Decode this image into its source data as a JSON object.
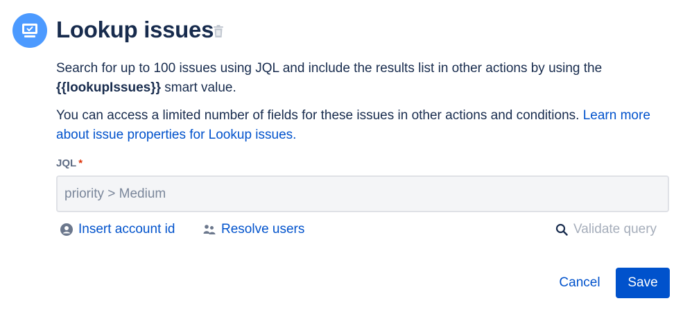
{
  "header": {
    "icon": "monitor-check-icon",
    "title": "Lookup issues",
    "delete_icon": "trash-icon"
  },
  "description": {
    "p1_text": "Search for up to 100 issues using JQL and include the results list in other actions by using the ",
    "p1_smart_value": "{{lookupIssues}}",
    "p1_suffix": " smart value.",
    "p2_text": "You can access a limited number of fields for these issues in other actions and conditions. ",
    "p2_link": "Learn more about issue properties for Lookup issues."
  },
  "form": {
    "jql_label": "JQL",
    "required_marker": "*",
    "jql_value": "",
    "jql_placeholder": "priority > Medium"
  },
  "actions": {
    "insert_account_id": "Insert account id",
    "insert_account_icon": "user-circle-icon",
    "resolve_users": "Resolve users",
    "resolve_users_icon": "people-icon",
    "validate_query": "Validate query",
    "validate_query_icon": "search-icon"
  },
  "footer": {
    "cancel_label": "Cancel",
    "save_label": "Save"
  },
  "colors": {
    "brand_blue": "#0052cc",
    "icon_circle": "#4c9aff",
    "text": "#172b4d",
    "required": "#de350b",
    "disabled_text": "#a5adba"
  }
}
